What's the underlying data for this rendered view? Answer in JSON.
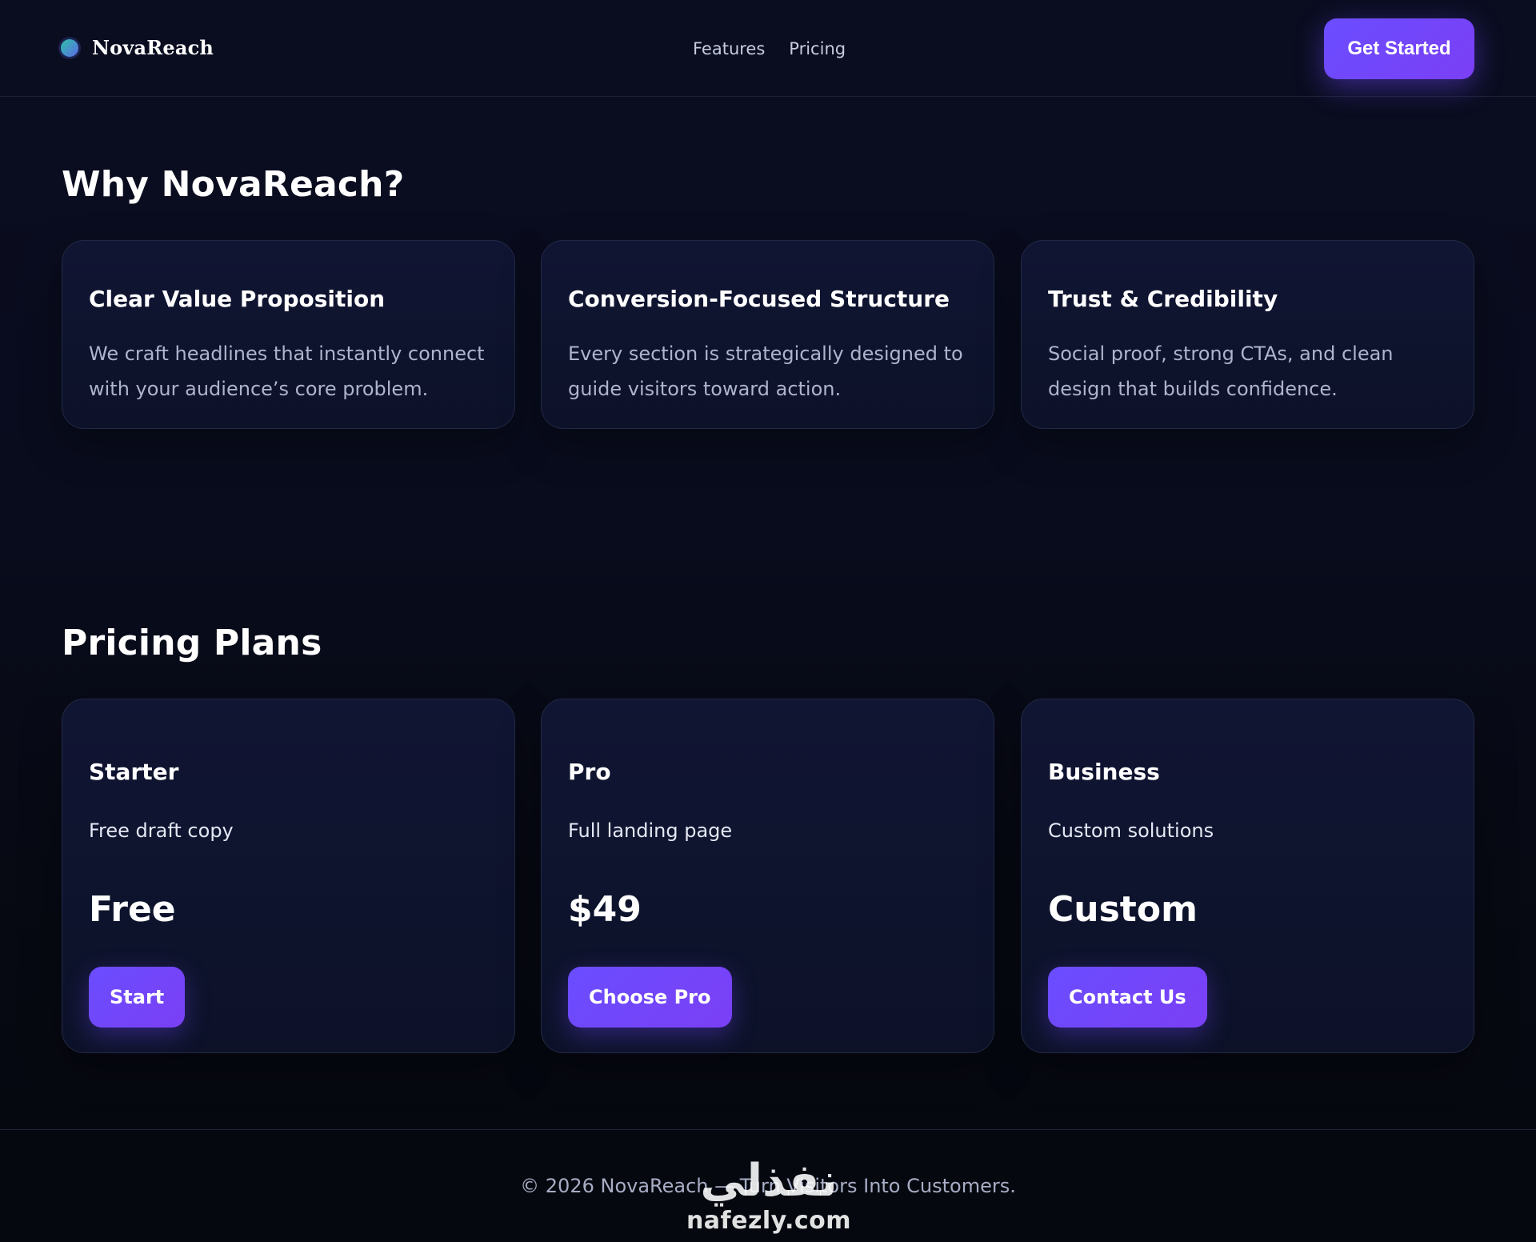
{
  "header": {
    "brand_name": "NovaReach",
    "nav": [
      {
        "label": "Features"
      },
      {
        "label": "Pricing"
      }
    ],
    "cta_label": "Get Started"
  },
  "features": {
    "title": "Why NovaReach?",
    "cards": [
      {
        "title": "Clear Value Proposition",
        "description": "We craft headlines that instantly connect with your audience’s core problem."
      },
      {
        "title": "Conversion-Focused Structure",
        "description": "Every section is strategically designed to guide visitors toward action."
      },
      {
        "title": "Trust & Credibility",
        "description": "Social proof, strong CTAs, and clean design that builds confidence."
      }
    ]
  },
  "pricing": {
    "title": "Pricing Plans",
    "plans": [
      {
        "name": "Starter",
        "subtitle": "Free draft copy",
        "price": "Free",
        "button": "Start"
      },
      {
        "name": "Pro",
        "subtitle": "Full landing page",
        "price": "$49",
        "button": "Choose Pro"
      },
      {
        "name": "Business",
        "subtitle": "Custom solutions",
        "price": "Custom",
        "button": "Contact Us"
      }
    ]
  },
  "footer": {
    "text": "© 2026 NovaReach — Turn Visitors Into Customers."
  },
  "watermark": {
    "arabic": "نفذلي",
    "latin": "nafezly.com"
  },
  "colors": {
    "background": "#090c1d",
    "card": "#0f1430",
    "accent": "#6a4dff",
    "accent_2": "#7b3ff5",
    "text_muted": "#aeb4cc"
  }
}
